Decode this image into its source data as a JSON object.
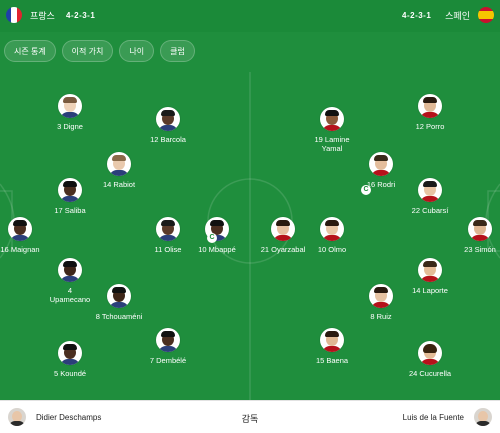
{
  "header": {
    "home": {
      "name": "프랑스",
      "formation": "4-2-3-1"
    },
    "away": {
      "name": "스페인",
      "formation": "4-2-3-1"
    }
  },
  "chips": [
    "시즌 통계",
    "이적 가치",
    "나이",
    "클럽"
  ],
  "players": [
    {
      "name": "3 Digne"
    },
    {
      "name": "12 Barcola"
    },
    {
      "name": "14 Rabiot"
    },
    {
      "name": "17 Saliba"
    },
    {
      "name": "16 Maignan"
    },
    {
      "name": "11 Olise"
    },
    {
      "name": "10 Mbappé",
      "captain": true
    },
    {
      "name": "4 Upamecano"
    },
    {
      "name": "8 Tchouaméni"
    },
    {
      "name": "5 Koundé"
    },
    {
      "name": "7 Dembélé"
    },
    {
      "name": "19 Lamine Yamal"
    },
    {
      "name": "12 Porro"
    },
    {
      "name": "16 Rodri",
      "captain": true
    },
    {
      "name": "22 Cubarsí"
    },
    {
      "name": "21 Oyarzabal"
    },
    {
      "name": "10 Olmo"
    },
    {
      "name": "23 Simón"
    },
    {
      "name": "14 Laporte"
    },
    {
      "name": "8 Ruiz"
    },
    {
      "name": "15 Baena"
    },
    {
      "name": "24 Cucurella"
    }
  ],
  "captain_mark": "C",
  "footer": {
    "home_coach": "Didier Deschamps",
    "label": "감독",
    "away_coach": "Luis de la Fuente"
  }
}
